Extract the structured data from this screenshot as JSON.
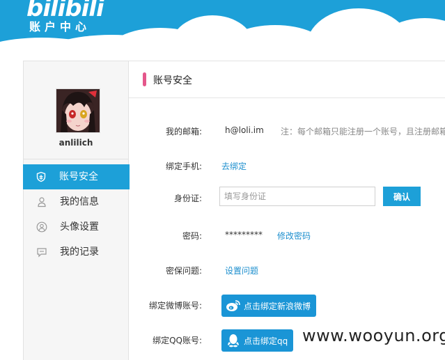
{
  "header": {
    "logo_text": "bilibili",
    "logo_subtitle": "账户中心"
  },
  "sidebar": {
    "username": "anlilich",
    "items": [
      {
        "label": "账号安全",
        "icon": "shield-icon",
        "active": true
      },
      {
        "label": "我的信息",
        "icon": "person-icon",
        "active": false
      },
      {
        "label": "头像设置",
        "icon": "avatar-circle-icon",
        "active": false
      },
      {
        "label": "我的记录",
        "icon": "chat-bubble-icon",
        "active": false
      }
    ]
  },
  "content": {
    "title": "账号安全",
    "email": {
      "label": "我的邮箱:",
      "value": "h@loli.im",
      "note": "注：每个邮箱只能注册一个账号，且注册邮箱"
    },
    "phone": {
      "label": "绑定手机:",
      "link": "去绑定"
    },
    "id_card": {
      "label": "身份证:",
      "placeholder": "填写身份证",
      "confirm_label": "确认"
    },
    "password": {
      "label": "密码:",
      "value": "*********",
      "link": "修改密码"
    },
    "security_question": {
      "label": "密保问题:",
      "link": "设置问题"
    },
    "weibo": {
      "label": "绑定微博账号:",
      "button": "点击绑定新浪微博"
    },
    "qq": {
      "label": "绑定QQ账号:",
      "button": "点击绑定qq"
    }
  },
  "watermark": "www.wooyun.org",
  "colors": {
    "brand_blue": "#1da0d8",
    "accent_pink": "#e4578b",
    "link_blue": "#1d8fce"
  }
}
